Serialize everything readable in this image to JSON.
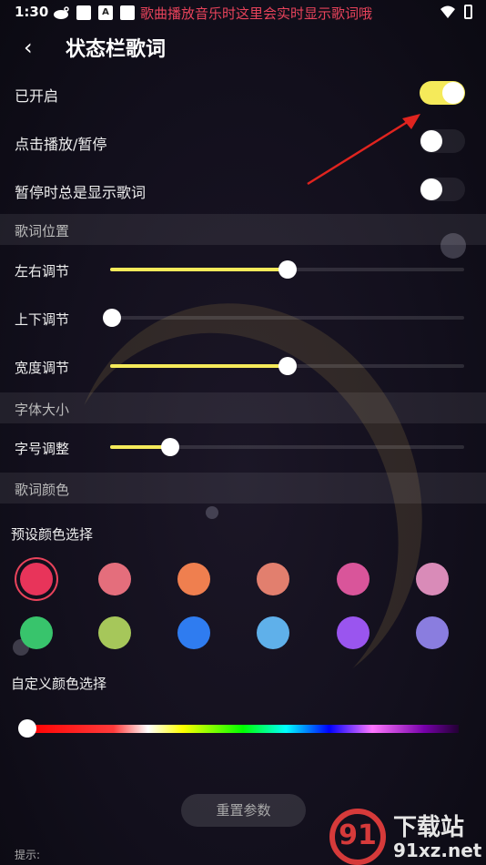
{
  "status_bar": {
    "time": "1:30",
    "ticker": "歌曲播放音乐时这里会实时显示歌词哦",
    "icons": [
      "weibo-icon",
      "app-icon",
      "a-icon",
      "app-icon",
      "wifi-icon",
      "battery-icon"
    ],
    "a_badge": "A"
  },
  "header": {
    "back_icon": "chevron-left-icon",
    "back_glyph": "‹",
    "title": "状态栏歌词"
  },
  "toggles": [
    {
      "label": "已开启",
      "on": true
    },
    {
      "label": "点击播放/暂停",
      "on": false
    },
    {
      "label": "暂停时总是显示歌词",
      "on": false
    }
  ],
  "sections": {
    "position": "歌词位置",
    "font": "字体大小",
    "color": "歌词颜色"
  },
  "sliders": {
    "horizontal": {
      "label": "左右调节",
      "value": 0.5
    },
    "vertical": {
      "label": "上下调节",
      "value": 0.0
    },
    "width": {
      "label": "宽度调节",
      "value": 0.5
    },
    "font_size": {
      "label": "字号调整",
      "value": 0.17
    }
  },
  "preset": {
    "label": "预设颜色选择",
    "selected_index": 0,
    "colors": [
      "#e8345a",
      "#e46e7c",
      "#ef7f4f",
      "#e27f6e",
      "#d9559a",
      "#d98bb8",
      "#38c46c",
      "#a6c75a",
      "#2f7cf0",
      "#5fb0ea",
      "#9a55ef",
      "#8a7ddf"
    ]
  },
  "custom": {
    "label": "自定义颜色选择",
    "value": 0.0
  },
  "reset_button": "重置参数",
  "hint": "提示:",
  "watermark": {
    "logo_text": "91",
    "top": "下载站",
    "bottom": "91xz.net"
  },
  "colors": {
    "accent": "#f5ea5a",
    "ticker": "#e8435b",
    "background": "#120f1c"
  }
}
